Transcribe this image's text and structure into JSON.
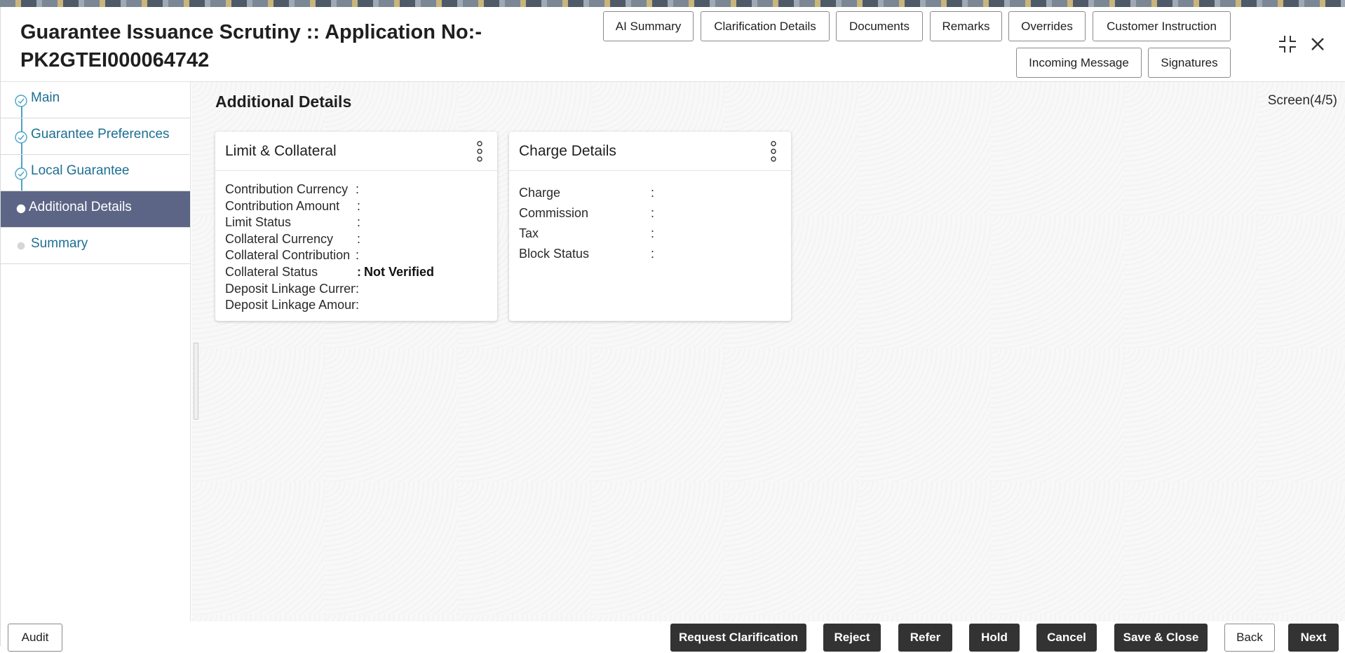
{
  "header": {
    "title": "Guarantee Issuance Scrutiny :: Application No:-\nPK2GTEI000064742",
    "buttons": {
      "ai_summary": "AI Summary",
      "clarification_details": "Clarification Details",
      "documents": "Documents",
      "remarks": "Remarks",
      "overrides": "Overrides",
      "customer_instruction": "Customer Instruction",
      "incoming_message": "Incoming Message",
      "signatures": "Signatures"
    },
    "icons": [
      "minimize-icon",
      "close-icon"
    ]
  },
  "sidebar": {
    "items": [
      {
        "label": "Main",
        "state": "completed"
      },
      {
        "label": "Guarantee Preferences",
        "state": "completed"
      },
      {
        "label": "Local Guarantee",
        "state": "completed"
      },
      {
        "label": "Additional Details",
        "state": "active"
      },
      {
        "label": "Summary",
        "state": "pending"
      }
    ]
  },
  "main": {
    "section_title": "Additional Details",
    "screen_indicator": "Screen(4/5)"
  },
  "cards": {
    "limit_collateral": {
      "title": "Limit & Collateral",
      "rows": [
        {
          "label": "Contribution Currency",
          "sep": ":",
          "value": ""
        },
        {
          "label": "Contribution Amount",
          "sep": ":",
          "value": ""
        },
        {
          "label": "Limit Status",
          "sep": ":",
          "value": ""
        },
        {
          "label": "Collateral Currency",
          "sep": ":",
          "value": ""
        },
        {
          "label": "Collateral Contribution",
          "sep": ":",
          "value": ""
        },
        {
          "label": "Collateral Status",
          "sep": ":",
          "value": "Not Verified"
        },
        {
          "label": "Deposit Linkage Currency",
          "sep": ":",
          "value": ""
        },
        {
          "label": "Deposit Linkage Amount",
          "sep": ":",
          "value": ""
        }
      ]
    },
    "charge_details": {
      "title": "Charge Details",
      "rows": [
        {
          "label": "Charge",
          "sep": ":",
          "value": ""
        },
        {
          "label": "Commission",
          "sep": ":",
          "value": ""
        },
        {
          "label": "Tax",
          "sep": ":",
          "value": ""
        },
        {
          "label": "Block Status",
          "sep": ":",
          "value": ""
        }
      ]
    }
  },
  "footer": {
    "audit": "Audit",
    "request_clarification": "Request Clarification",
    "reject": "Reject",
    "refer": "Refer",
    "hold": "Hold",
    "cancel": "Cancel",
    "save_close": "Save & Close",
    "back": "Back",
    "next": "Next"
  },
  "colors": {
    "active_step_bg": "#5c6585",
    "link": "#1d6f93",
    "dark_button": "#333333"
  }
}
